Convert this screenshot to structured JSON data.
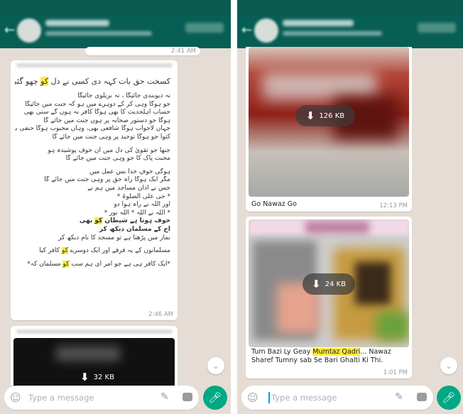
{
  "left": {
    "chat_name": "",
    "top_time": "2:41 AM",
    "message1": {
      "lines": [
        {
          "text": "کسخت حق بات کہہ دی کسی نے دل کو چھو گئی",
          "hl": "کو",
          "emoji": true,
          "style": "big"
        },
        {
          "text": "",
          "style": "gap"
        },
        {
          "text": "نہ دیوبندی جائیگا ، نہ بریلوی جائیگا",
          "style": "n"
        },
        {
          "text": "جو ہوگا وہی کر کے دوہرے میں ہو کہ جنت میں جائیگا",
          "style": "n"
        },
        {
          "text": "حساب اہلحدیث کا بھی ہوگا کافر نہ ہوں گے سنی بھی",
          "style": "n"
        },
        {
          "text": "ہوگا جو دستور صحابہ پر ہوں جنت میں جائے گا",
          "style": "n"
        },
        {
          "text": "جہاں لاجواب ہوگا شافعی بھی، وہاں محبوب ہوگا حنفی بھی",
          "style": "n"
        },
        {
          "text": "کتوا جو ہوگا توحید پر وہی جنت میں جائے گا",
          "style": "n"
        },
        {
          "text": "",
          "style": "gap"
        },
        {
          "text": "جنھا جو تقویٰ کی دل میں ان خوف پوشیدہ ہو",
          "style": "n"
        },
        {
          "text": "محبت پاک کا جو وہی جنت میں جائے گا",
          "style": "n"
        },
        {
          "text": "",
          "style": "gap"
        },
        {
          "text": "ہوگی خوفِ خدا بس عمل میں",
          "style": "n"
        },
        {
          "text": "مگر ایک ہوگا راہ حق پر وہی جنت میں جائے گا",
          "style": "n"
        },
        {
          "text": "جس نے اذان مساجد میں ہم نے",
          "style": "n"
        },
        {
          "text": "* حی علی الصلوۃ *",
          "style": "n"
        },
        {
          "text": "اور اللہ نے راہ ہوا دو",
          "style": "n"
        },
        {
          "text": "* اللہ نے اللہ * اللہ نور *",
          "style": "n"
        },
        {
          "text": "خوف ہوتا ہے شیطان کو بھی",
          "hl": "کو",
          "style": "b"
        },
        {
          "text": "آج کے مسلمان دیکھ کر",
          "style": "b"
        },
        {
          "text": "نماز میں پڑھتا ہے تو مسجد کا نام دیکھ کر",
          "style": "n"
        },
        {
          "text": "",
          "style": "gap"
        },
        {
          "text": "مسلمانوں کے یہ فرقے اور ایک دوسرے کو کافر کیا",
          "hl": "کو",
          "style": "n"
        },
        {
          "text": "",
          "style": "gap"
        },
        {
          "text": "*ایک کافر ہی ہے جو امر ای ہم سب کو مسلمان کہ*",
          "hl": "کو",
          "style": "n"
        }
      ],
      "time": "2:46 AM"
    },
    "message2": {
      "download_label": "32 KB"
    },
    "input_placeholder": "Type a message"
  },
  "right": {
    "chat_name": "",
    "card1": {
      "download_label": "126 KB",
      "caption": "Go Nawaz Go",
      "time": "12:13 PM"
    },
    "card2": {
      "download_label": "24 KB",
      "caption_line1_pre": "Tum Bazi Ly Geay ",
      "caption_line1_hl": "Mumtaz Qadri",
      "caption_line1_post": "... Nawaz",
      "caption_line2": "Sharef Tumny sab Se Bari Ghalti Ki Thi.",
      "time": "1:01 PM"
    },
    "input_placeholder": "Type a message"
  },
  "colors": {
    "header": "#075e54",
    "chat_bg": "#e5ddd5",
    "highlight": "#ffeb3b",
    "send_button": "#00a884"
  },
  "icons": {
    "emoji": "smiley-icon",
    "attach": "paperclip-icon",
    "camera": "camera-icon",
    "mic": "microphone-icon",
    "download": "download-arrow-icon",
    "scroll": "double-chevron-down-icon"
  }
}
